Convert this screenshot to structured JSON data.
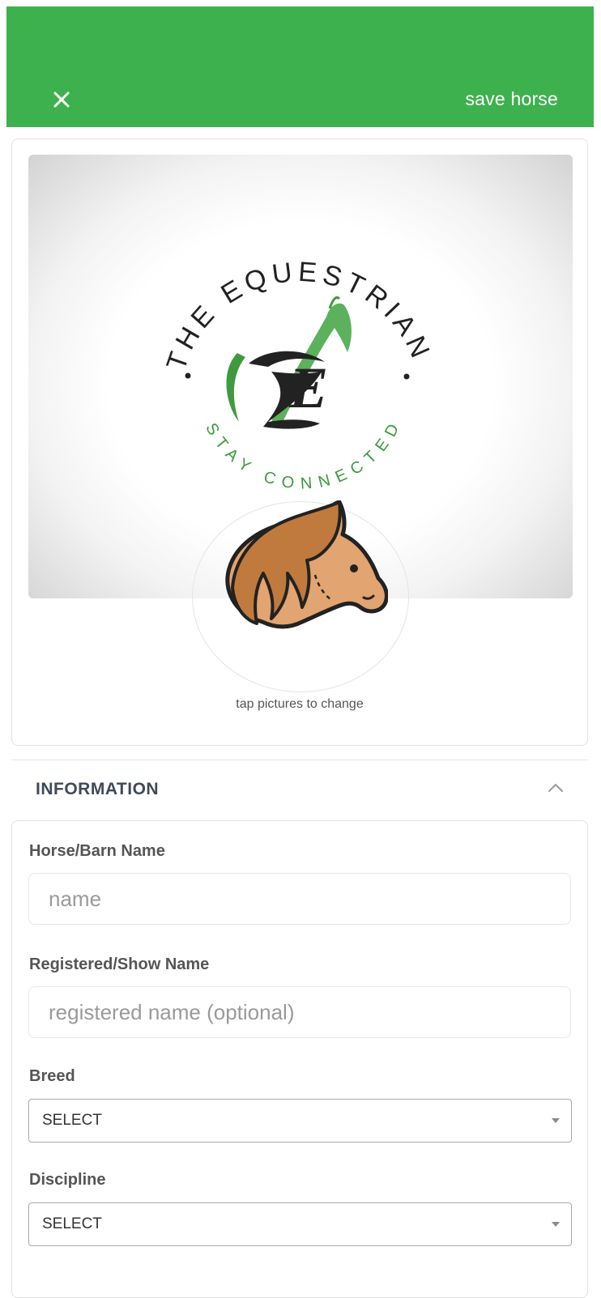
{
  "header": {
    "save_label": "save horse",
    "close_icon": "close-icon",
    "bg_color": "#3db14e"
  },
  "photos": {
    "cover_logo": {
      "top_text": "THE EQUESTRIAN",
      "bottom_text": "STAY CONNECTED",
      "monogram": "E"
    },
    "hint": "tap pictures to change"
  },
  "information": {
    "title": "INFORMATION",
    "chevron_icon": "chevron-up-icon",
    "fields": {
      "horse_name": {
        "label": "Horse/Barn Name",
        "placeholder": "name",
        "value": ""
      },
      "show_name": {
        "label": "Registered/Show Name",
        "placeholder": "registered name (optional)",
        "value": ""
      },
      "breed": {
        "label": "Breed",
        "selected": "SELECT"
      },
      "discipline": {
        "label": "Discipline",
        "selected": "SELECT"
      }
    }
  }
}
